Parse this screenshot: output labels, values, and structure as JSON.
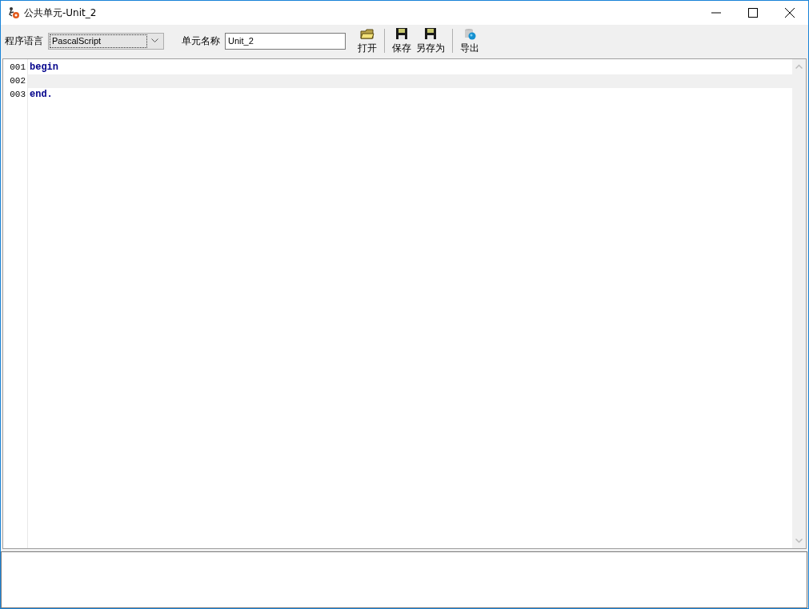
{
  "window": {
    "title": "公共单元-Unit_2"
  },
  "toolbar": {
    "language_label": "程序语言",
    "language_value": "PascalScript",
    "unit_label": "单元名称",
    "unit_value": "Unit_2",
    "items": [
      {
        "kind": "open",
        "label": "打开"
      },
      {
        "kind": "separator"
      },
      {
        "kind": "save",
        "label": "保存"
      },
      {
        "kind": "save_as",
        "label": "另存为"
      },
      {
        "kind": "separator"
      },
      {
        "kind": "export",
        "label": "导出"
      }
    ]
  },
  "editor": {
    "lines": [
      {
        "number": "001",
        "code": "begin",
        "current": false
      },
      {
        "number": "002",
        "current": true
      },
      {
        "number": "003",
        "code": "end.",
        "current": false
      }
    ]
  }
}
